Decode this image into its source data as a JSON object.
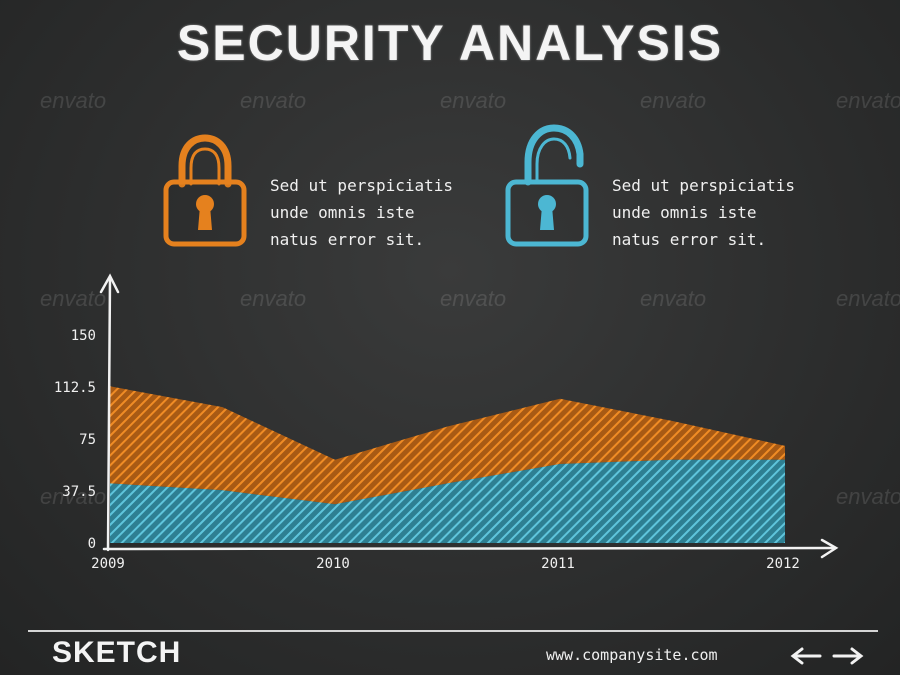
{
  "title": "SECURITY ANALYSIS",
  "watermark": "envato",
  "locks": [
    {
      "state": "locked",
      "icon": "lock-icon",
      "color": "#e5811e",
      "text_lines": [
        "Sed ut perspiciatis",
        "unde omnis iste",
        "natus error sit."
      ]
    },
    {
      "state": "unlocked",
      "icon": "unlock-icon",
      "color": "#4cb7d3",
      "text_lines": [
        "Sed ut perspiciatis",
        "unde omnis iste",
        "natus error sit."
      ]
    }
  ],
  "chart_data": {
    "type": "area",
    "stacked": true,
    "categories": [
      "2009",
      "2010",
      "2011",
      "2012"
    ],
    "x": [
      2009,
      2010,
      2011,
      2012
    ],
    "yticks": [
      "0",
      "37.5",
      "75",
      "112.5",
      "150"
    ],
    "ylim": [
      0,
      150
    ],
    "series": [
      {
        "color": "#3fa7bd",
        "points": [
          [
            2009,
            43
          ],
          [
            2009.5,
            38
          ],
          [
            2010,
            28
          ],
          [
            2010.5,
            43
          ],
          [
            2011,
            57
          ],
          [
            2011.5,
            60
          ],
          [
            2012,
            60
          ]
        ]
      },
      {
        "color": "#e5811e",
        "points": [
          [
            2009,
            113
          ],
          [
            2009.5,
            98
          ],
          [
            2010,
            60
          ],
          [
            2010.5,
            84
          ],
          [
            2011,
            104
          ],
          [
            2011.5,
            88
          ],
          [
            2012,
            70
          ]
        ]
      }
    ],
    "grid": false,
    "legend": "none"
  },
  "footer": {
    "brand": "SKETCH",
    "website": "www.companysite.com",
    "nav": [
      "arrow-left-icon",
      "arrow-right-icon"
    ]
  }
}
